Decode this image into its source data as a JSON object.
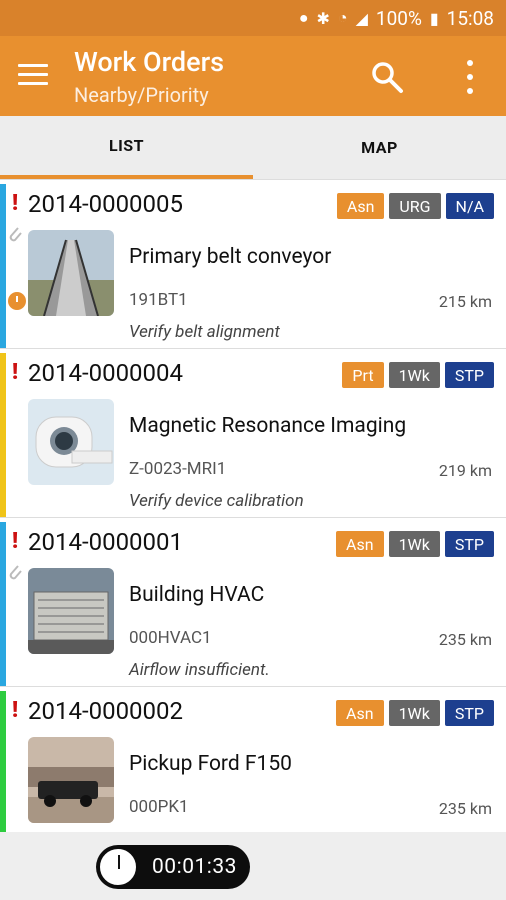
{
  "status": {
    "battery": "100%",
    "time": "15:08"
  },
  "header": {
    "title": "Work Orders",
    "subtitle": "Nearby/Priority"
  },
  "tabs": [
    {
      "label": "LIST"
    },
    {
      "label": "MAP"
    }
  ],
  "work_orders": [
    {
      "number": "2014-0000005",
      "badges": [
        "Asn",
        "URG",
        "N/A"
      ],
      "asset_name": "Primary belt conveyor",
      "asset_code": "191BT1",
      "distance": "215 km",
      "note": "Verify belt alignment",
      "accent": "#2aa7e0"
    },
    {
      "number": "2014-0000004",
      "badges": [
        "Prt",
        "1Wk",
        "STP"
      ],
      "asset_name": "Magnetic Resonance Imaging",
      "asset_code": "Z-0023-MRI1",
      "distance": "219 km",
      "note": "Verify device calibration",
      "accent": "#f0c419"
    },
    {
      "number": "2014-0000001",
      "badges": [
        "Asn",
        "1Wk",
        "STP"
      ],
      "asset_name": "Building HVAC",
      "asset_code": "000HVAC1",
      "distance": "235 km",
      "note": "Airflow insufficient.",
      "accent": "#2aa7e0"
    },
    {
      "number": "2014-0000002",
      "badges": [
        "Asn",
        "1Wk",
        "STP"
      ],
      "asset_name": "Pickup Ford F150",
      "asset_code": "000PK1",
      "distance": "235 km",
      "note": "",
      "accent": "#2ecc40"
    }
  ],
  "stopwatch": {
    "time": "00:01:33"
  },
  "colors": {
    "primary": "#e8902f",
    "badge_orange": "#e8902f",
    "badge_gray": "#666666",
    "badge_blue": "#1d3f8f"
  }
}
